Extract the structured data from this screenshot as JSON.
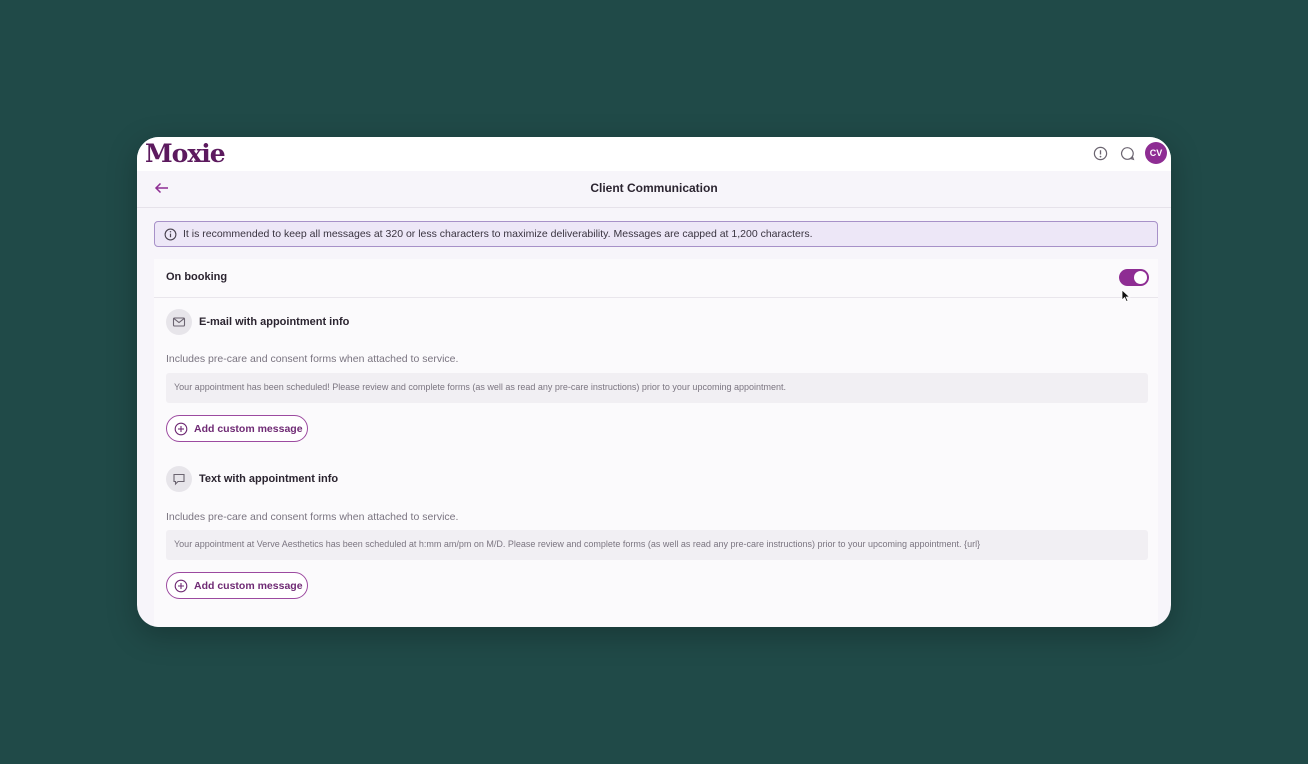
{
  "app": {
    "logo": "Moxie",
    "avatar_initials": "CV",
    "accent_color": "#8e2d93"
  },
  "header": {
    "title": "Client Communication"
  },
  "notice": {
    "text": "It is recommended to keep all messages at 320 or less characters to maximize deliverability. Messages are capped at 1,200 characters."
  },
  "section": {
    "title": "On booking",
    "enabled": true
  },
  "email": {
    "title": "E-mail with appointment info",
    "description": "Includes pre-care and consent forms when attached to service.",
    "message": "Your appointment has been scheduled! Please review and complete forms (as well as read any pre-care instructions) prior to your upcoming appointment.",
    "button_label": "Add custom message"
  },
  "text": {
    "title": "Text with appointment info",
    "description": "Includes pre-care and consent forms when attached to service.",
    "message": "Your appointment at Verve Aesthetics has been scheduled at h:mm am/pm on M/D. Please review and complete forms (as well as read any pre-care instructions) prior to your upcoming appointment. {url}",
    "button_label": "Add custom message"
  },
  "icons": {
    "top_bar": [
      "alert-circle-icon",
      "chat-icon"
    ],
    "back": "arrow-left-icon",
    "notice": "info-icon",
    "email": "mail-icon",
    "text": "message-icon",
    "button": "plus-circle-icon"
  }
}
